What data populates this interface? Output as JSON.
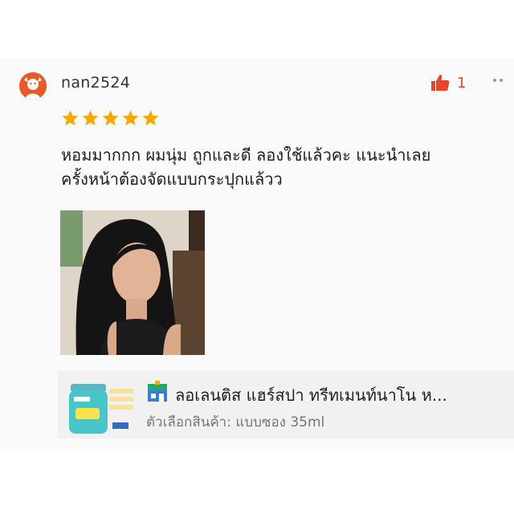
{
  "review": {
    "username": "nan2524",
    "like_count": "1",
    "rating": 5,
    "text_lines": [
      "หอมมากกก ผมนุ่ม ถูกและดี ลองใช้แล้วคะ แนะนำเลย",
      "ครั้งหน้าต้องจัดแบบกระปุกแล้วว"
    ]
  },
  "product": {
    "name": "ลอเลนติส แฮร์สปา ทรีทเมนท์นาโน ห...",
    "variation_label": "ตัวเลือกสินค้า: แบบซอง 35ml"
  },
  "colors": {
    "accent": "#e8452b",
    "star": "#f6a700",
    "product_bg": "#f1f1f1"
  }
}
